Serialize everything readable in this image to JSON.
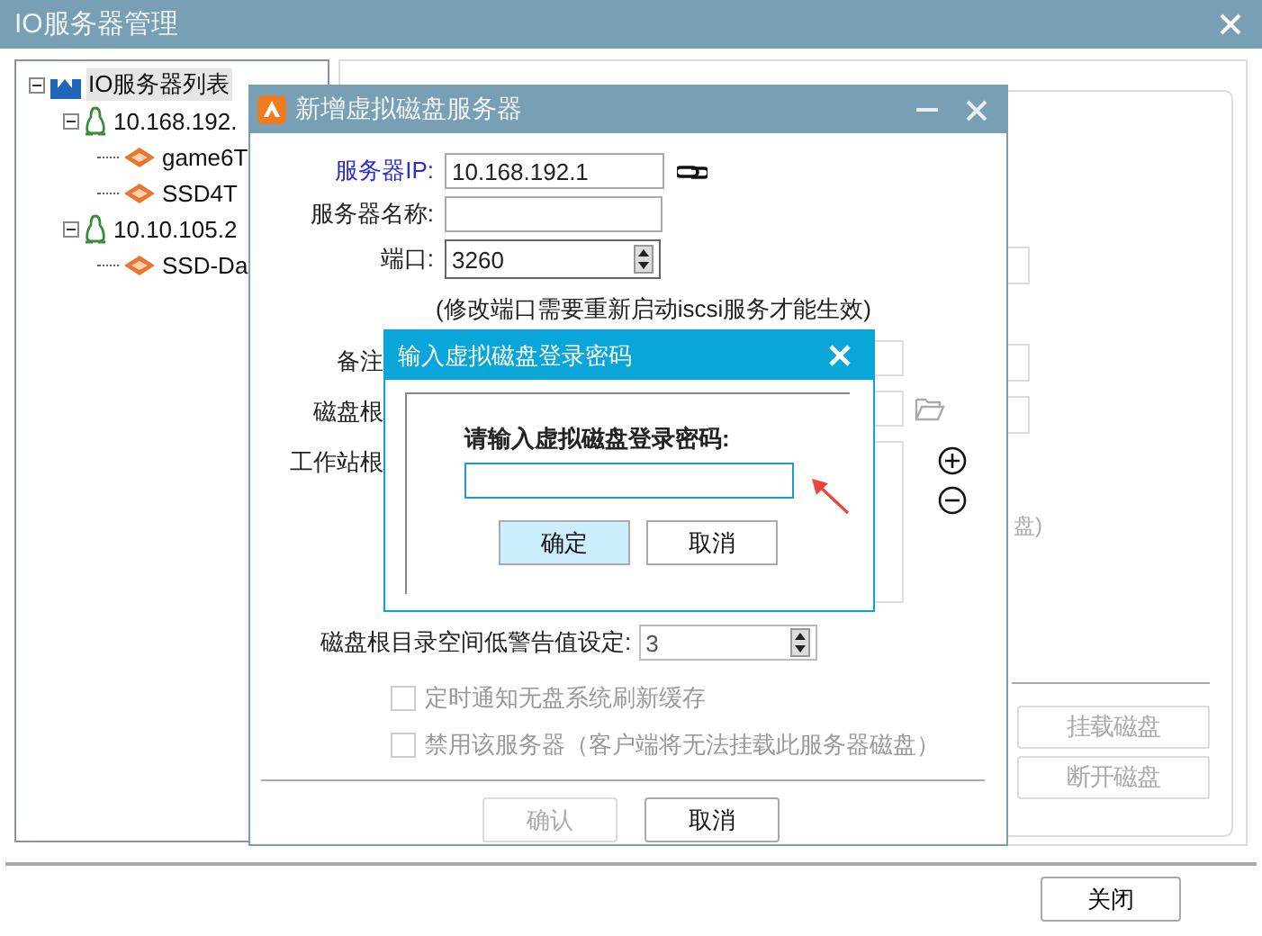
{
  "window": {
    "title": "IO服务器管理"
  },
  "tree": {
    "label": "IO服务器列表",
    "kind": "root",
    "selected": true,
    "expanded": true,
    "children": [
      {
        "label": "10.168.192.",
        "kind": "server",
        "selected": false,
        "expanded": true,
        "children": [
          {
            "label": "game6T",
            "kind": "disk",
            "selected": false
          },
          {
            "label": "SSD4T",
            "kind": "disk",
            "selected": false
          }
        ]
      },
      {
        "label": "10.10.105.2",
        "kind": "server",
        "selected": false,
        "expanded": true,
        "children": [
          {
            "label": "SSD-Da",
            "kind": "disk",
            "selected": false
          }
        ]
      }
    ]
  },
  "properties_panel": {
    "hint_fragment": "盘)",
    "buttons": [
      {
        "label": "挂载磁盘",
        "disabled": true
      },
      {
        "label": "断开磁盘",
        "disabled": true
      }
    ]
  },
  "footer": {
    "buttons": [
      {
        "label": "关闭",
        "disabled": false
      }
    ]
  },
  "server_dialog": {
    "title": "新增虚拟磁盘服务器",
    "ip": {
      "label": "服务器IP:",
      "value": "10.168.192.1"
    },
    "name": {
      "label": "服务器名称:"
    },
    "port": {
      "label": "端口:",
      "value": "3260"
    },
    "port_note": "(修改端口需要重新启动iscsi服务才能生效)",
    "remark_label": "备注",
    "root_label": "磁盘根",
    "workstation_label": "工作站根",
    "warning": {
      "label": "磁盘根目录空间低警告值设定:",
      "value": "3"
    },
    "options": [
      {
        "label": "定时通知无盘系统刷新缓存",
        "checked": false,
        "disabled": true
      },
      {
        "label": "禁用该服务器（客户端将无法挂载此服务器磁盘）",
        "checked": false,
        "disabled": true
      }
    ],
    "buttons": [
      {
        "label": "确认",
        "disabled": true
      },
      {
        "label": "取消",
        "disabled": false
      }
    ]
  },
  "password_dialog": {
    "title": "输入虚拟磁盘登录密码",
    "prompt": "请输入虚拟磁盘登录密码:",
    "buttons": [
      {
        "label": "确定",
        "default": true
      },
      {
        "label": "取消",
        "default": false
      }
    ]
  }
}
